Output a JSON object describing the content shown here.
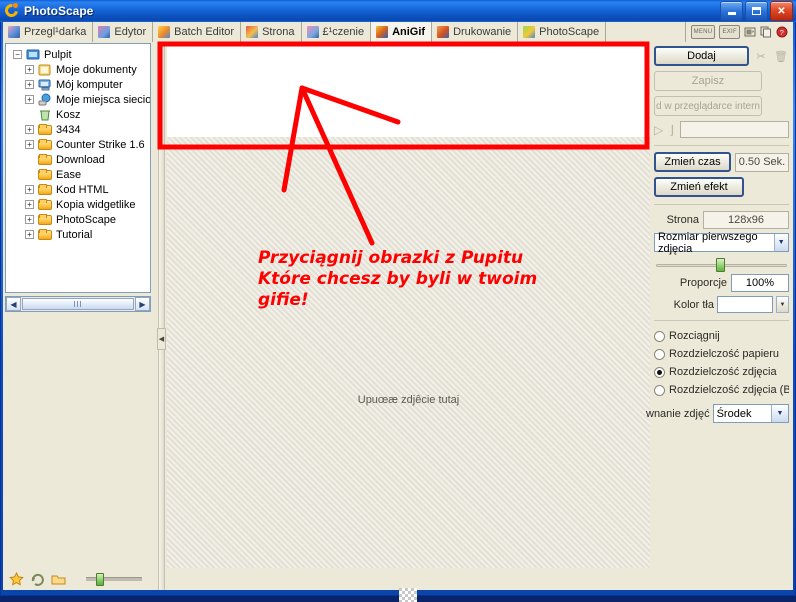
{
  "window": {
    "title": "PhotoScape",
    "app_icon": "photoscape-logo-icon",
    "buttons": {
      "minimize": "minimize-icon",
      "maximize": "maximize-icon",
      "close": "close-icon"
    }
  },
  "tabbar": {
    "tabs": [
      {
        "label": "Przegl¹darka",
        "icon": "browser-icon",
        "active": false
      },
      {
        "label": "Edytor",
        "icon": "editor-icon",
        "active": false
      },
      {
        "label": "Batch Editor",
        "icon": "batch-editor-icon",
        "active": false
      },
      {
        "label": "Strona",
        "icon": "page-icon",
        "active": false
      },
      {
        "label": "£¹czenie",
        "icon": "combine-icon",
        "active": false
      },
      {
        "label": "AniGif",
        "icon": "anigif-icon",
        "active": true
      },
      {
        "label": "Drukowanie",
        "icon": "print-icon",
        "active": false
      },
      {
        "label": "PhotoScape",
        "icon": "photoscape-icon",
        "active": false
      }
    ],
    "tools": [
      {
        "label": "MENU",
        "icon": "menu-icon"
      },
      {
        "label": "EXIF",
        "icon": "exif-icon"
      },
      {
        "label": "",
        "icon": "screen-capture-icon"
      },
      {
        "label": "",
        "icon": "copy-icon"
      },
      {
        "label": "",
        "icon": "help-icon"
      }
    ]
  },
  "sidebar": {
    "tree": [
      {
        "label": "Pulpit",
        "depth": 0,
        "toggle": "minus",
        "icon": "desktop-icon"
      },
      {
        "label": "Moje dokumenty",
        "depth": 1,
        "toggle": "plus",
        "icon": "documents-folder-icon"
      },
      {
        "label": "Mój komputer",
        "depth": 1,
        "toggle": "plus",
        "icon": "my-computer-icon"
      },
      {
        "label": "Moje miejsca sieciowe",
        "depth": 1,
        "toggle": "plus",
        "icon": "network-places-icon"
      },
      {
        "label": "Kosz",
        "depth": 1,
        "toggle": "none",
        "icon": "recycle-bin-icon"
      },
      {
        "label": "3434",
        "depth": 1,
        "toggle": "plus",
        "icon": "folder-icon"
      },
      {
        "label": "Counter Strike 1.6",
        "depth": 1,
        "toggle": "plus",
        "icon": "folder-icon"
      },
      {
        "label": "Download",
        "depth": 1,
        "toggle": "none",
        "icon": "folder-icon"
      },
      {
        "label": "Ease",
        "depth": 1,
        "toggle": "none",
        "icon": "folder-icon"
      },
      {
        "label": "Kod HTML",
        "depth": 1,
        "toggle": "plus",
        "icon": "folder-icon"
      },
      {
        "label": "Kopia widgetlike",
        "depth": 1,
        "toggle": "plus",
        "icon": "folder-icon"
      },
      {
        "label": "PhotoScape",
        "depth": 1,
        "toggle": "plus",
        "icon": "folder-icon"
      },
      {
        "label": "Tutorial",
        "depth": 1,
        "toggle": "plus",
        "icon": "folder-icon"
      }
    ],
    "scroll_left": "◀",
    "scroll_right": "▶",
    "status_icons": [
      "favorites-star-icon",
      "refresh-icon",
      "open-folder-icon"
    ]
  },
  "canvas": {
    "drop_hint": "Upuœæ zdjêcie tutaj",
    "annotation": {
      "lines": [
        "Przyciągnij obrazki z Pupitu",
        "Które chcesz by byli w twoim",
        "gifie!"
      ],
      "color": "#FF0000",
      "arrow": "red-hand-drawn-arrow"
    },
    "transparency_swatch": "checkerboard-icon"
  },
  "right_panel": {
    "add_button": "Dodaj",
    "save_button": "Zapisz",
    "browser_button": "d w przeglądarce intern",
    "play_icon": "play-icon",
    "stop_icon": "stop-icon",
    "playback_field": "",
    "change_time_button": "Zmień czas",
    "time_value": "0.50 Sek.",
    "change_effect_button": "Zmień efekt",
    "page_label": "Strona",
    "page_size": "128x96",
    "size_mode": "Rozmiar pierwszego zdjęcia",
    "proportion_label": "Proporcje",
    "proportion_value": "100%",
    "bg_color_label": "Kolor tła",
    "bg_color": "#FFFFFF",
    "cut_icon": "scissors-icon",
    "delete_icon": "trash-icon",
    "radios": [
      {
        "label": "Rozciągnij",
        "selected": false
      },
      {
        "label": "Rozdzielczość papieru",
        "selected": false
      },
      {
        "label": "Rozdzielczość zdjęcia",
        "selected": true
      },
      {
        "label": "Rozdzielczość zdjęcia (Bez pov",
        "selected": false
      }
    ],
    "align_label": "wnanie zdjęć",
    "align_value": "Środek"
  },
  "colors": {
    "title_blue": "#1060D8",
    "face": "#ECE9D8",
    "accent_red": "#FF0000",
    "border": "#ACA899"
  }
}
